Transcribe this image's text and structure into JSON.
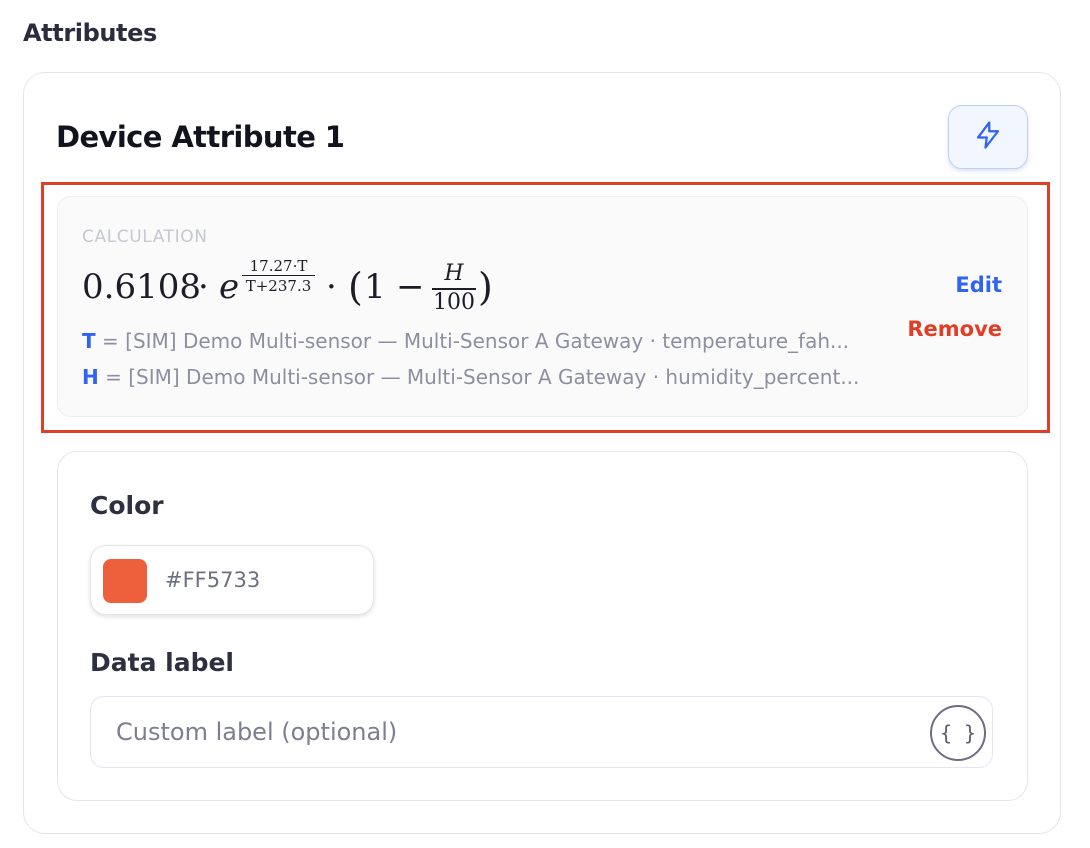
{
  "section": {
    "title": "Attributes"
  },
  "attribute": {
    "title": "Device Attribute 1",
    "action_icon": "lightning-bolt-icon",
    "calculation": {
      "heading": "CALCULATION",
      "formula": {
        "coefficient": "0.6108",
        "dot": "·",
        "base": "e",
        "exponent_numerator": "17.27·T",
        "exponent_denominator": "T+237.3",
        "open_paren": "(",
        "one": "1",
        "minus": "−",
        "fraction_numerator": "H",
        "fraction_denominator": "100",
        "close_paren": ")"
      },
      "variables": [
        {
          "symbol": "T",
          "equals": " = ",
          "source": "[SIM] Demo Multi-sensor — Multi-Sensor A Gateway · temperature_fah..."
        },
        {
          "symbol": "H",
          "equals": " = ",
          "source": "[SIM] Demo Multi-sensor — Multi-Sensor A Gateway · humidity_percent..."
        }
      ],
      "edit_label": "Edit",
      "remove_label": "Remove"
    },
    "color": {
      "label": "Color",
      "value": "#FF5733",
      "swatch_color": "#ee5f3c"
    },
    "data_label": {
      "label": "Data label",
      "value": "",
      "placeholder": "Custom label (optional)",
      "template_button_icon": "braces-icon",
      "template_button_text": "{ }"
    }
  },
  "colors": {
    "accent_blue": "#2f64f3",
    "danger_red": "#e13e27",
    "highlight_border": "#e13e27"
  }
}
